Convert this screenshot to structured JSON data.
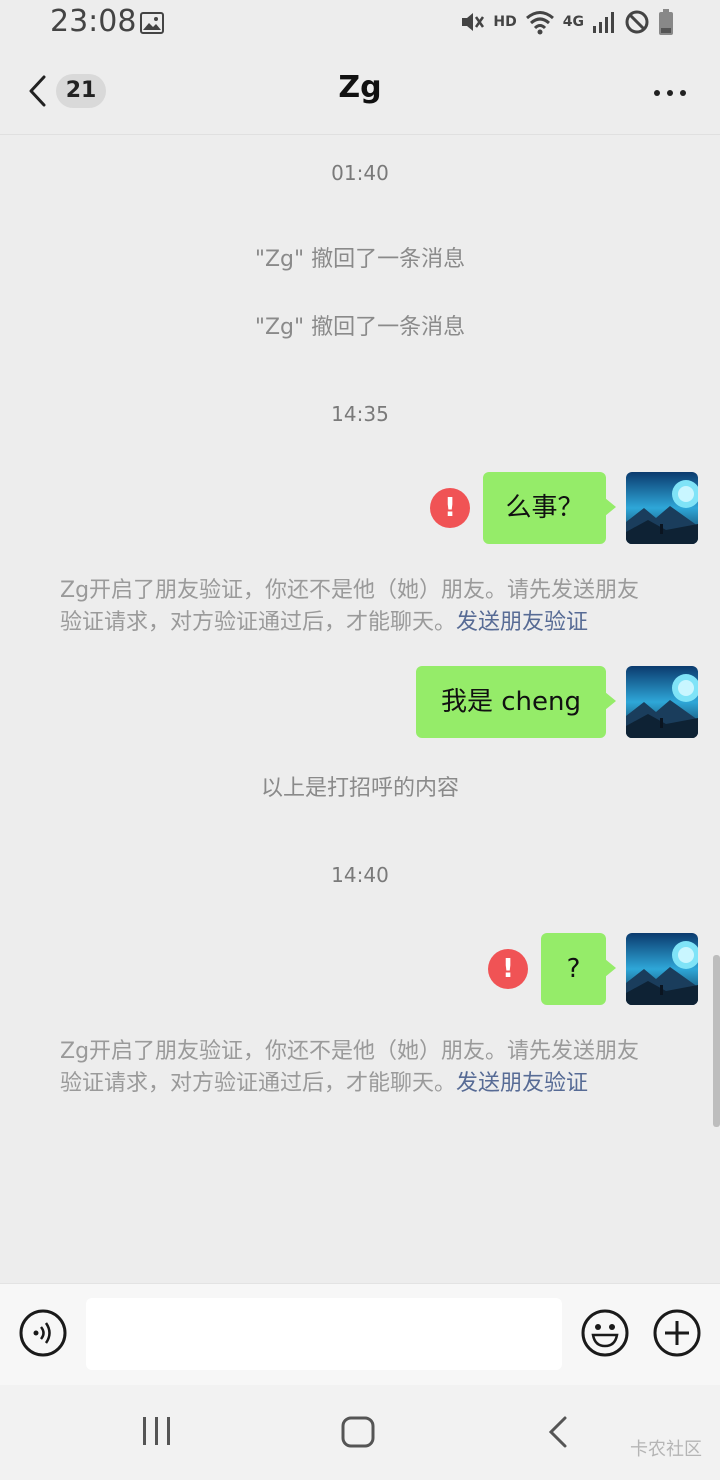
{
  "status_bar": {
    "time": "23:08",
    "network": "HD",
    "cellular": "4G"
  },
  "header": {
    "unread_count": "21",
    "title": "Zg"
  },
  "chat": {
    "timestamps": [
      "01:40",
      "14:35",
      "14:40"
    ],
    "recall_1": "\"Zg\" 撤回了一条消息",
    "recall_2": "\"Zg\" 撤回了一条消息",
    "messages": [
      {
        "text": "么事？",
        "failed": true
      },
      {
        "text": "我是 cheng",
        "failed": false
      },
      {
        "text": "?",
        "failed": true
      }
    ],
    "notice_1": {
      "text": "Zg开启了朋友验证，你还不是他（她）朋友。请先发送朋友验证请求，对方验证通过后，才能聊天。",
      "link": "发送朋友验证"
    },
    "greeting_note": "以上是打招呼的内容",
    "notice_2": {
      "text": "Zg开启了朋友验证，你还不是他（她）朋友。请先发送朋友验证请求，对方验证通过后，才能聊天。",
      "link": "发送朋友验证"
    },
    "error_mark": "!"
  },
  "input_bar": {
    "placeholder": ""
  },
  "watermark": "卡农社区",
  "colors": {
    "bubble": "#95ec69",
    "error": "#f05355",
    "link": "#576b95",
    "background": "#ededed"
  },
  "icons": [
    "gallery-icon",
    "mute-icon",
    "wifi-icon",
    "signal-icon",
    "dnd-icon",
    "battery-icon",
    "back-icon",
    "more-icon",
    "voice-icon",
    "emoji-icon",
    "plus-icon"
  ]
}
